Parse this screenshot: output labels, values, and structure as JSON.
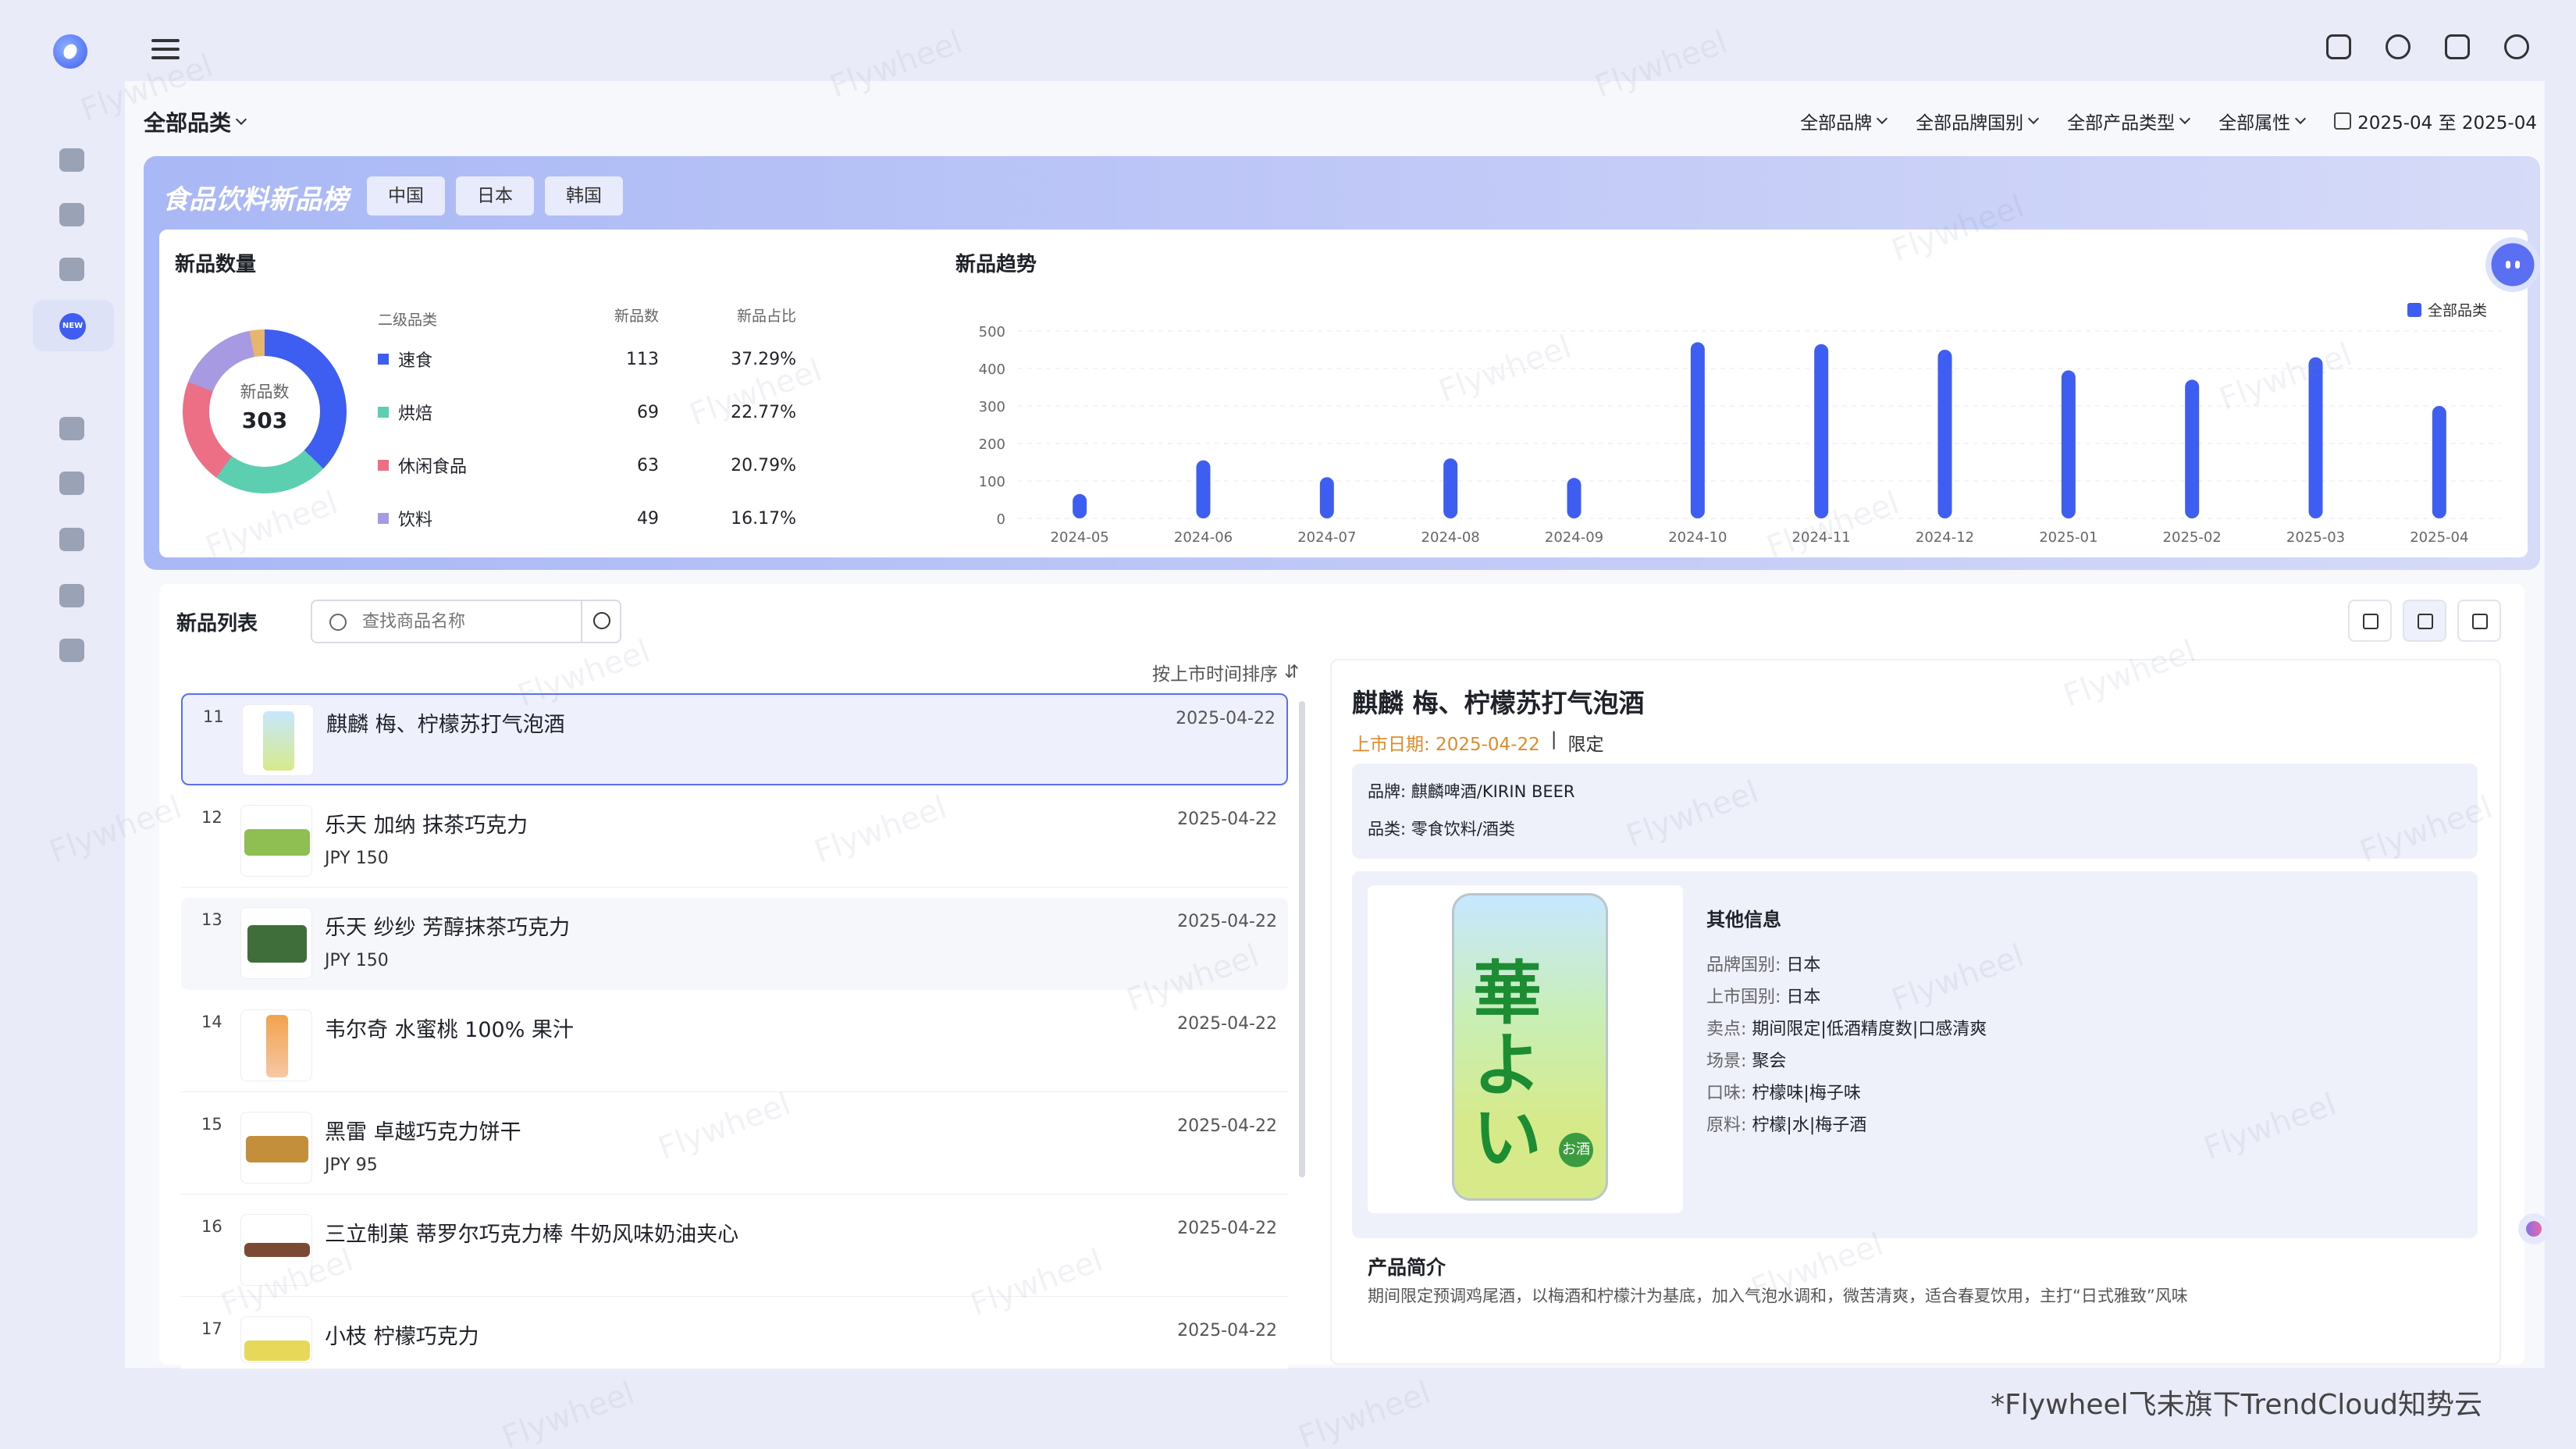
{
  "header": {
    "category": "全部品类",
    "filters": [
      "全部品牌",
      "全部品牌国别",
      "全部产品类型",
      "全部属性"
    ],
    "date_range": "2025-04 至 2025-04",
    "top_icons": [
      "message-icon",
      "help-icon",
      "translate-icon",
      "user-icon"
    ]
  },
  "sidebar": {
    "icons": [
      "trend-icon",
      "tag-icon",
      "analysis-icon",
      "new-icon",
      "apps-icon",
      "discount-icon",
      "bag-icon",
      "review-icon",
      "bot-icon"
    ],
    "new_badge": "NEW"
  },
  "banner": {
    "title": "食品饮料新品榜",
    "countries": [
      "中国",
      "日本",
      "韩国"
    ]
  },
  "stats": {
    "count_title": "新品数量",
    "trend_title": "新品趋势",
    "donut_label": "新品数",
    "donut_value": "303",
    "table_headers": [
      "二级品类",
      "新品数",
      "新品占比"
    ],
    "categories": [
      {
        "name": "速食",
        "count": "113",
        "share": "37.29%",
        "color": "#3d5ef0"
      },
      {
        "name": "烘焙",
        "count": "69",
        "share": "22.77%",
        "color": "#5ccfb0"
      },
      {
        "name": "休闲食品",
        "count": "63",
        "share": "20.79%",
        "color": "#ec6f86"
      },
      {
        "name": "饮料",
        "count": "49",
        "share": "16.17%",
        "color": "#a79ae3"
      }
    ]
  },
  "chart_data": {
    "type": "bar",
    "categories": [
      "2024-05",
      "2024-06",
      "2024-07",
      "2024-08",
      "2024-09",
      "2024-10",
      "2024-11",
      "2024-12",
      "2025-01",
      "2025-02",
      "2025-03",
      "2025-04"
    ],
    "series": [
      {
        "name": "全部品类",
        "values": [
          65,
          155,
          110,
          160,
          108,
          470,
          465,
          450,
          395,
          370,
          430,
          300
        ]
      }
    ],
    "y_ticks": [
      "0",
      "100",
      "200",
      "300",
      "400",
      "500"
    ],
    "ylim": [
      0,
      500
    ],
    "legend_position": "top-right",
    "color": "#3d5ef0"
  },
  "list": {
    "title": "新品列表",
    "search_placeholder": "查找商品名称",
    "sort_label": "按上市时间排序",
    "products": [
      {
        "index": "11",
        "name": "麒麟 梅、柠檬苏打气泡酒",
        "price": "",
        "date": "2025-04-22"
      },
      {
        "index": "12",
        "name": "乐天 加纳 抹茶巧克力",
        "price": "JPY 150",
        "date": "2025-04-22"
      },
      {
        "index": "13",
        "name": "乐天 纱纱 芳醇抹茶巧克力",
        "price": "JPY 150",
        "date": "2025-04-22"
      },
      {
        "index": "14",
        "name": "韦尔奇 水蜜桃 100% 果汁",
        "price": "",
        "date": "2025-04-22"
      },
      {
        "index": "15",
        "name": "黑雷 卓越巧克力饼干",
        "price": "JPY 95",
        "date": "2025-04-22"
      },
      {
        "index": "16",
        "name": "三立制菓 蒂罗尔巧克力棒 牛奶风味奶油夹心",
        "price": "",
        "date": "2025-04-22"
      },
      {
        "index": "17",
        "name": "小枝 柠檬巧克力",
        "price": "",
        "date": "2025-04-22"
      }
    ]
  },
  "detail": {
    "title": "麒麟 梅、柠檬苏打气泡酒",
    "launch_date": "上市日期: 2025-04-22",
    "separator": "|",
    "tag": "限定",
    "brand": "品牌: 麒麟啤酒/KIRIN BEER",
    "category": "品类: 零食饮料/酒类",
    "can_text": "華よい",
    "can_badge": "お酒",
    "other_title": "其他信息",
    "attributes": [
      {
        "label": "品牌国别: ",
        "value": "日本"
      },
      {
        "label": "上市国别: ",
        "value": "日本"
      },
      {
        "label": "卖点: ",
        "value": "期间限定|低酒精度数|口感清爽"
      },
      {
        "label": "场景: ",
        "value": "聚会"
      },
      {
        "label": "口味: ",
        "value": "柠檬味|梅子味"
      },
      {
        "label": "原料: ",
        "value": "柠檬|水|梅子酒"
      }
    ],
    "intro_title": "产品简介",
    "intro_text": "期间限定预调鸡尾酒，以梅酒和柠檬汁为基底，加入气泡水调和，微苦清爽，适合春夏饮用，主打“日式雅致”风味"
  },
  "watermark": "Flywheel",
  "footer": "*Flywheel飞未旗下TrendCloud知势云"
}
